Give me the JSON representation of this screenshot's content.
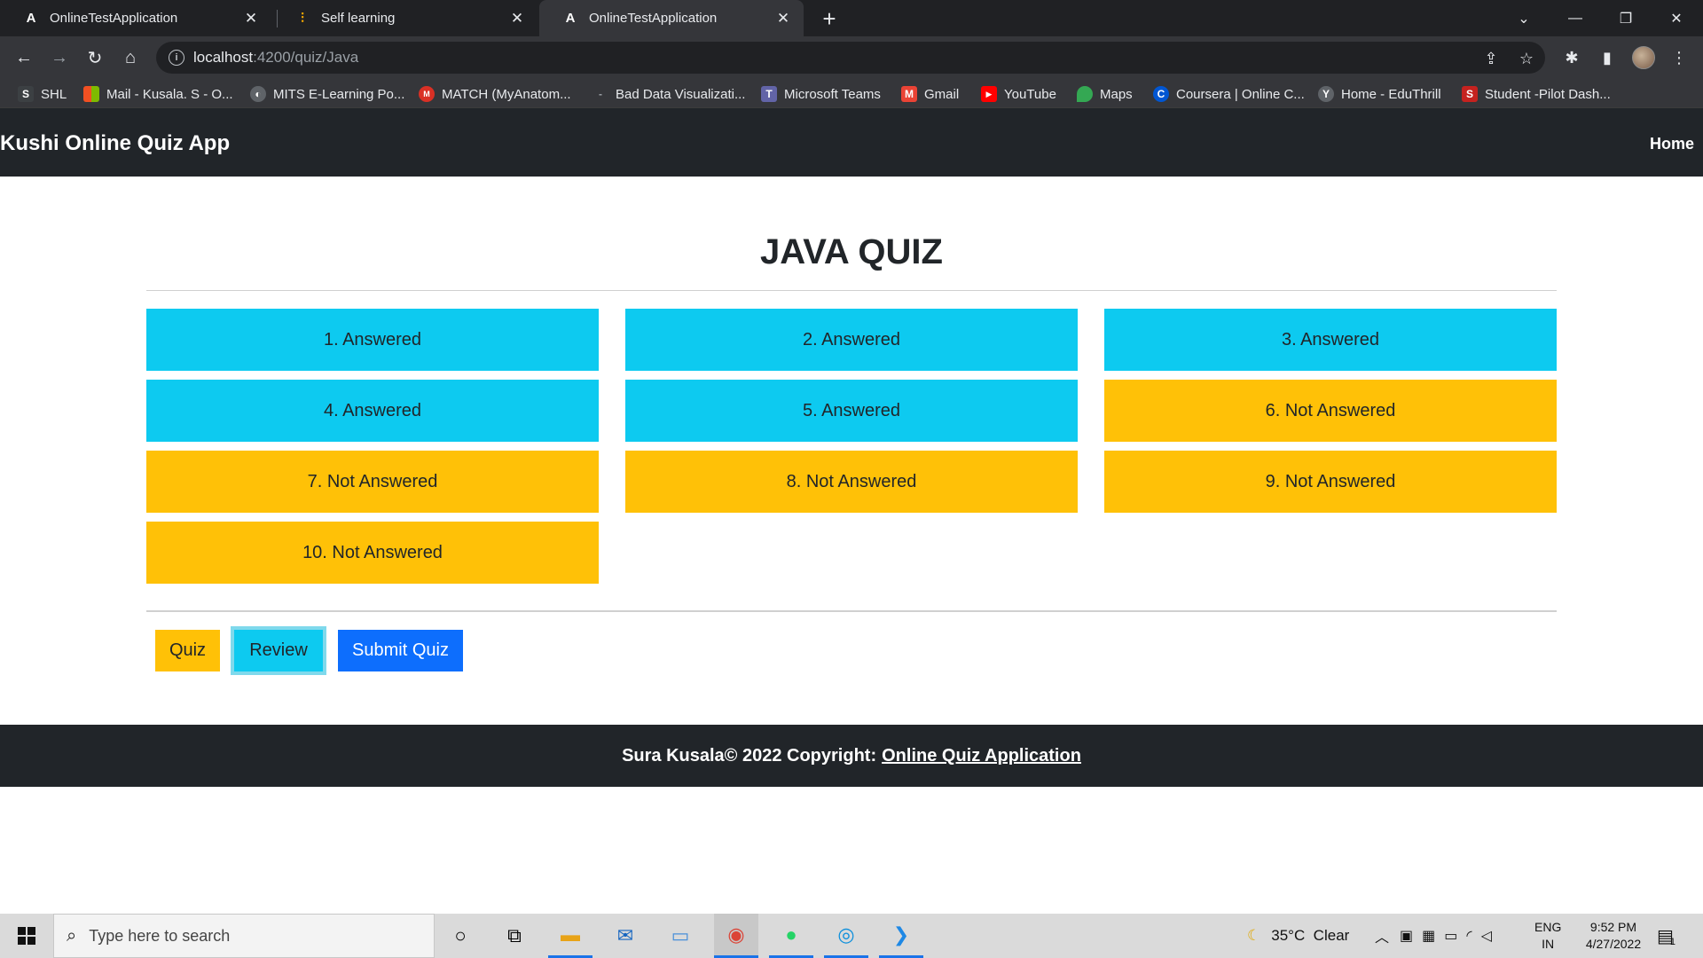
{
  "browser": {
    "tabs": [
      {
        "title": "OnlineTestApplication",
        "icon": "angular-icon",
        "active": false
      },
      {
        "title": "Self learning",
        "icon": "chart-bars-icon",
        "active": false
      },
      {
        "title": "OnlineTestApplication",
        "icon": "angular-icon",
        "active": true
      }
    ],
    "url": {
      "host": "localhost",
      "path": ":4200/quiz/Java"
    },
    "bookmarks": [
      {
        "label": "SHL",
        "icon": "shl-icon",
        "color": "#3c4043"
      },
      {
        "label": "Mail - Kusala. S - O...",
        "icon": "microsoft-icon",
        "color": "#f25022"
      },
      {
        "label": "MITS E-Learning Po...",
        "icon": "globe-icon",
        "color": "#5f6368"
      },
      {
        "label": "MATCH (MyAnatom...",
        "icon": "match-icon",
        "color": "#d93025"
      },
      {
        "label": "Bad Data Visualizati...",
        "icon": "dash-icon",
        "color": "#35363a"
      },
      {
        "label": "Microsoft Teams",
        "icon": "teams-icon",
        "color": "#6264a7"
      },
      {
        "label": "Gmail",
        "icon": "gmail-icon",
        "color": "#ea4335"
      },
      {
        "label": "YouTube",
        "icon": "youtube-icon",
        "color": "#ff0000"
      },
      {
        "label": "Maps",
        "icon": "maps-icon",
        "color": "#34a853"
      },
      {
        "label": "Coursera | Online C...",
        "icon": "coursera-icon",
        "color": "#0056d2"
      },
      {
        "label": "Home - EduThrill",
        "icon": "eduthrill-icon",
        "color": "#5f6368"
      },
      {
        "label": "Student -Pilot Dash...",
        "icon": "student-icon",
        "color": "#c5221f"
      }
    ]
  },
  "app": {
    "brand": "Kushi Online Quiz App",
    "nav_home": "Home",
    "title": "JAVA QUIZ",
    "questions": [
      {
        "label": "1. Answered",
        "status": "answered"
      },
      {
        "label": "2. Answered",
        "status": "answered"
      },
      {
        "label": "3. Answered",
        "status": "answered"
      },
      {
        "label": "4. Answered",
        "status": "answered"
      },
      {
        "label": "5. Answered",
        "status": "answered"
      },
      {
        "label": "6. Not Answered",
        "status": "not-answered"
      },
      {
        "label": "7. Not Answered",
        "status": "not-answered"
      },
      {
        "label": "8. Not Answered",
        "status": "not-answered"
      },
      {
        "label": "9. Not Answered",
        "status": "not-answered"
      },
      {
        "label": "10. Not Answered",
        "status": "not-answered"
      }
    ],
    "actions": {
      "quiz": "Quiz",
      "review": "Review",
      "submit": "Submit Quiz"
    },
    "footer": {
      "text": "Sura Kusala© 2022 Copyright:",
      "link": "Online Quiz Application"
    },
    "colors": {
      "answered": "#0dcaf0",
      "not_answered": "#ffc107",
      "primary": "#0d6efd",
      "dark": "#212529"
    }
  },
  "taskbar": {
    "search_placeholder": "Type here to search",
    "weather": "35°C  Clear",
    "lang_top": "ENG",
    "lang_bottom": "IN",
    "time": "9:52 PM",
    "date": "4/27/2022",
    "notifications": "1"
  }
}
